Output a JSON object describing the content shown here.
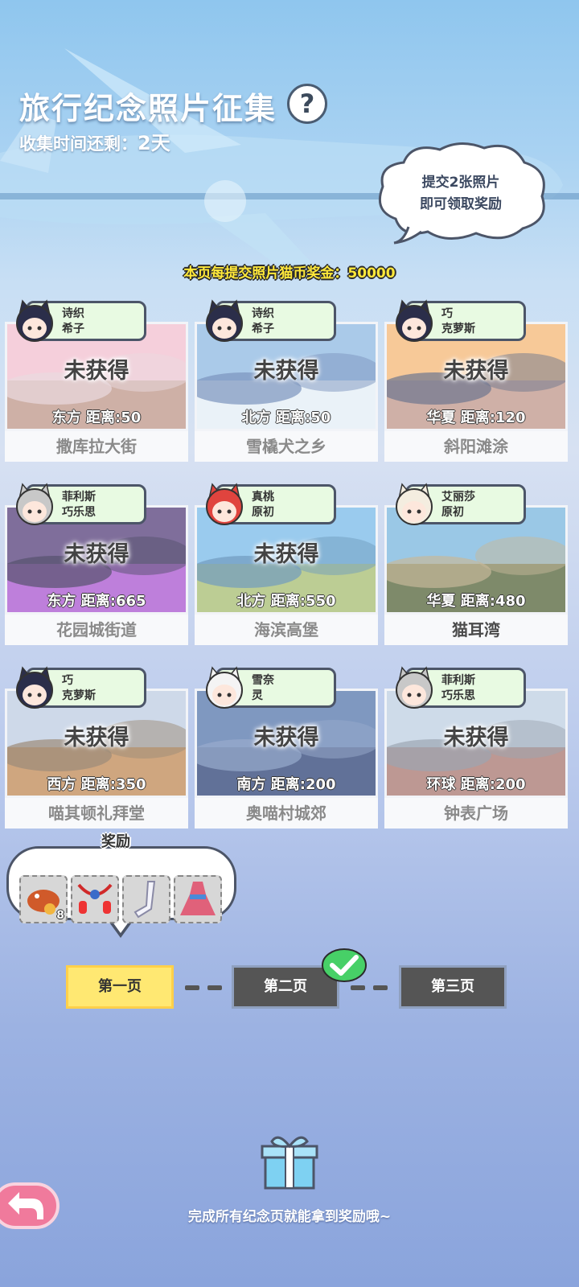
{
  "header": {
    "title": "旅行纪念照片征集",
    "help_icon": "question-icon",
    "time_label": "收集时间还剩：",
    "time_value": "2天",
    "cloud_line1": "提交2张照片",
    "cloud_line2": "即可领取奖励",
    "bonus_text": "本页每提交照片猫币奖金：50000"
  },
  "cards": [
    {
      "chars": [
        "诗织",
        "希子"
      ],
      "status": "未获得",
      "direction": "东方",
      "distance": "距离:50",
      "location": "撒库拉大街",
      "done": false
    },
    {
      "chars": [
        "诗织",
        "希子"
      ],
      "status": "未获得",
      "direction": "北方",
      "distance": "距离:50",
      "location": "雪橇犬之乡",
      "done": false
    },
    {
      "chars": [
        "巧",
        "克萝斯"
      ],
      "status": "未获得",
      "direction": "华夏",
      "distance": "距离:120",
      "location": "斜阳滩涂",
      "done": false
    },
    {
      "chars": [
        "菲利斯",
        "巧乐思"
      ],
      "status": "未获得",
      "direction": "东方",
      "distance": "距离:665",
      "location": "花园城街道",
      "done": false
    },
    {
      "chars": [
        "真桃",
        "原初"
      ],
      "status": "未获得",
      "direction": "北方",
      "distance": "距离:550",
      "location": "海滨高堡",
      "done": false
    },
    {
      "chars": [
        "艾丽莎",
        "原初"
      ],
      "status": "",
      "direction": "华夏",
      "distance": "距离:480",
      "location": "猫耳湾",
      "done": true
    },
    {
      "chars": [
        "巧",
        "克萝斯"
      ],
      "status": "未获得",
      "direction": "西方",
      "distance": "距离:350",
      "location": "喵其顿礼拜堂",
      "done": false
    },
    {
      "chars": [
        "雪奈",
        "灵"
      ],
      "status": "未获得",
      "direction": "南方",
      "distance": "距离:200",
      "location": "奥喵村城郊",
      "done": false
    },
    {
      "chars": [
        "菲利斯",
        "巧乐思"
      ],
      "status": "未获得",
      "direction": "环球",
      "distance": "距离:200",
      "location": "钟表广场",
      "done": false
    }
  ],
  "rewards": {
    "label": "奖励",
    "items": [
      {
        "icon": "catfish-icon",
        "count": "8"
      },
      {
        "icon": "lantern-necklace-icon",
        "count": ""
      },
      {
        "icon": "stockings-icon",
        "count": ""
      },
      {
        "icon": "dress-icon",
        "count": ""
      }
    ]
  },
  "pages": [
    "第一页",
    "第二页",
    "第三页"
  ],
  "footer": {
    "text": "完成所有纪念页就能拿到奖励哦~",
    "gift_icon": "gift-icon",
    "back_icon": "back-arrow-icon"
  },
  "colors": {
    "accent": "#ffe872",
    "tag_bg": "#e8fae2",
    "bonus": "#ffe83a",
    "back": "#f07a9c"
  }
}
